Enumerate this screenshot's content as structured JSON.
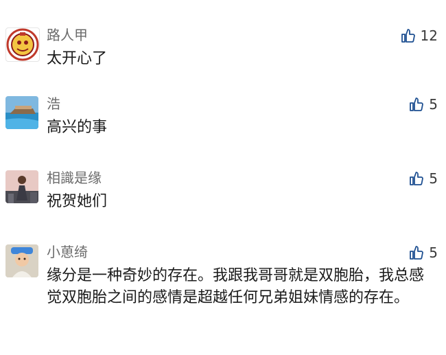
{
  "comments": [
    {
      "username": "路人甲",
      "text": "太开心了",
      "likes": "12",
      "avatar": "badge-avatar"
    },
    {
      "username": "浩",
      "text": "高兴的事",
      "likes": "5",
      "avatar": "seaside-avatar"
    },
    {
      "username": "相識是缘",
      "text": "祝贺她们",
      "likes": "5",
      "avatar": "figure-avatar"
    },
    {
      "username": "小葸绮",
      "text": "缘分是一种奇妙的存在。我跟我哥哥就是双胞胎，我总感觉双胞胎之间的感情是超越任何兄弟姐妹情感的存在。",
      "likes": "5",
      "avatar": "child-avatar"
    }
  ],
  "icons": {
    "like": "thumbs-up-icon"
  },
  "colors": {
    "username": "#6b6b6b",
    "text": "#1a1a1a",
    "icon": "#1d4f91"
  }
}
